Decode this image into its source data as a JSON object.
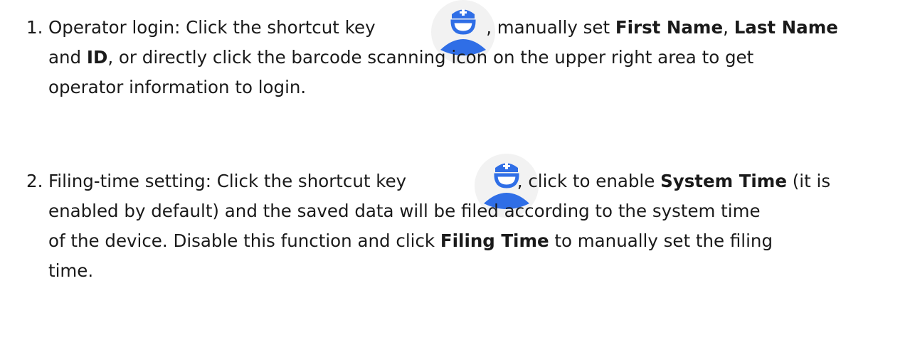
{
  "items": [
    {
      "number": "1.",
      "prefix": "Operator login: Click the shortcut key",
      "icon": "operator-icon",
      "after_icon": ", manually set",
      "bold1": "First Name",
      "comma": ",",
      "bold2": "Last Name",
      "l2_and": "and",
      "l2_bold": "ID",
      "l2_rest": ", or directly click the barcode scanning icon on the upper right area to get",
      "l3": "operator information to login."
    },
    {
      "number": "2.",
      "prefix": "Filing-time setting: Click the shortcut key",
      "icon": "operator-icon",
      "after_icon": ", click to enable",
      "bold1": "System Time",
      "after_bold1": "(it is",
      "l2": "enabled by default) and the saved data will be filed according to the system time",
      "l3_pre": "of the device. Disable this function and click",
      "l3_bold": "Filing Time",
      "l3_post": "to manually set the filing",
      "l4": "time."
    }
  ],
  "colors": {
    "icon_blue": "#2f6ee6",
    "icon_circle": "#f2f2f2"
  }
}
